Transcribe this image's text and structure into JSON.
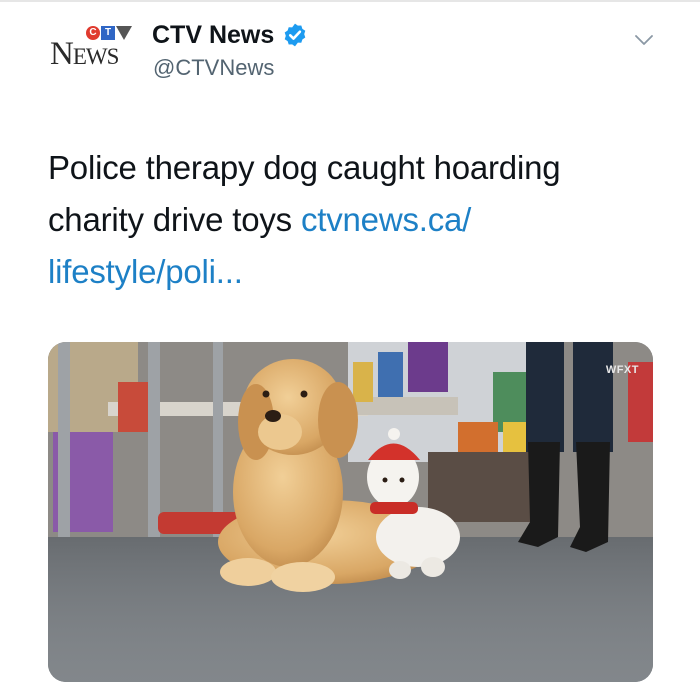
{
  "account": {
    "logo_small": [
      "C",
      "T",
      "V"
    ],
    "logo_word": "News",
    "name": "CTV News",
    "handle": "@CTVNews",
    "verified": true
  },
  "menu": {
    "icon": "chevron-down-icon"
  },
  "tweet": {
    "text": "Police therapy dog caught hoarding charity drive toys ",
    "link": "ctvnews.ca/ lifestyle/poli..."
  },
  "media": {
    "watermark": "WFXT",
    "description_icon": "photo"
  },
  "colors": {
    "link": "#1d80c6",
    "verified": "#1d9bf0",
    "handle": "#536471",
    "ctv_red": "#e03a2e",
    "ctv_blue": "#2f66c5"
  }
}
